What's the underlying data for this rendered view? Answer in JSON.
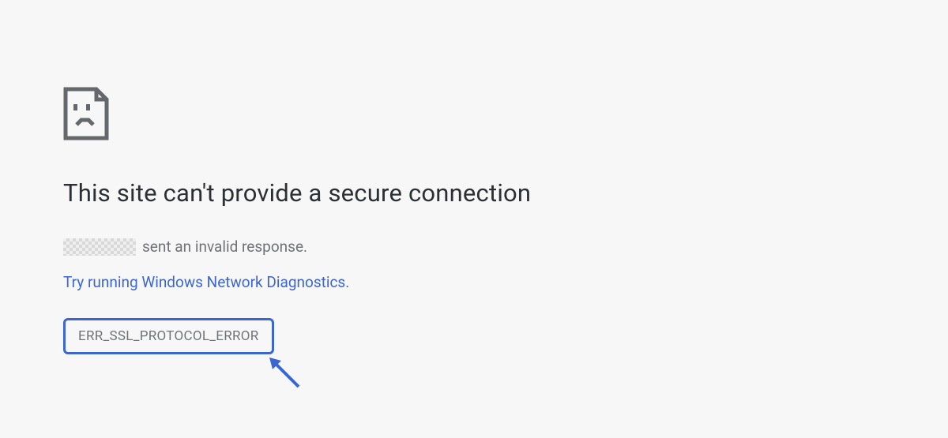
{
  "error": {
    "title": "This site can't provide a secure connection",
    "message_suffix": "sent an invalid response.",
    "diagnostics_link": "Try running Windows Network Diagnostics.",
    "error_code": "ERR_SSL_PROTOCOL_ERROR",
    "accent_color": "#3b66d1"
  }
}
